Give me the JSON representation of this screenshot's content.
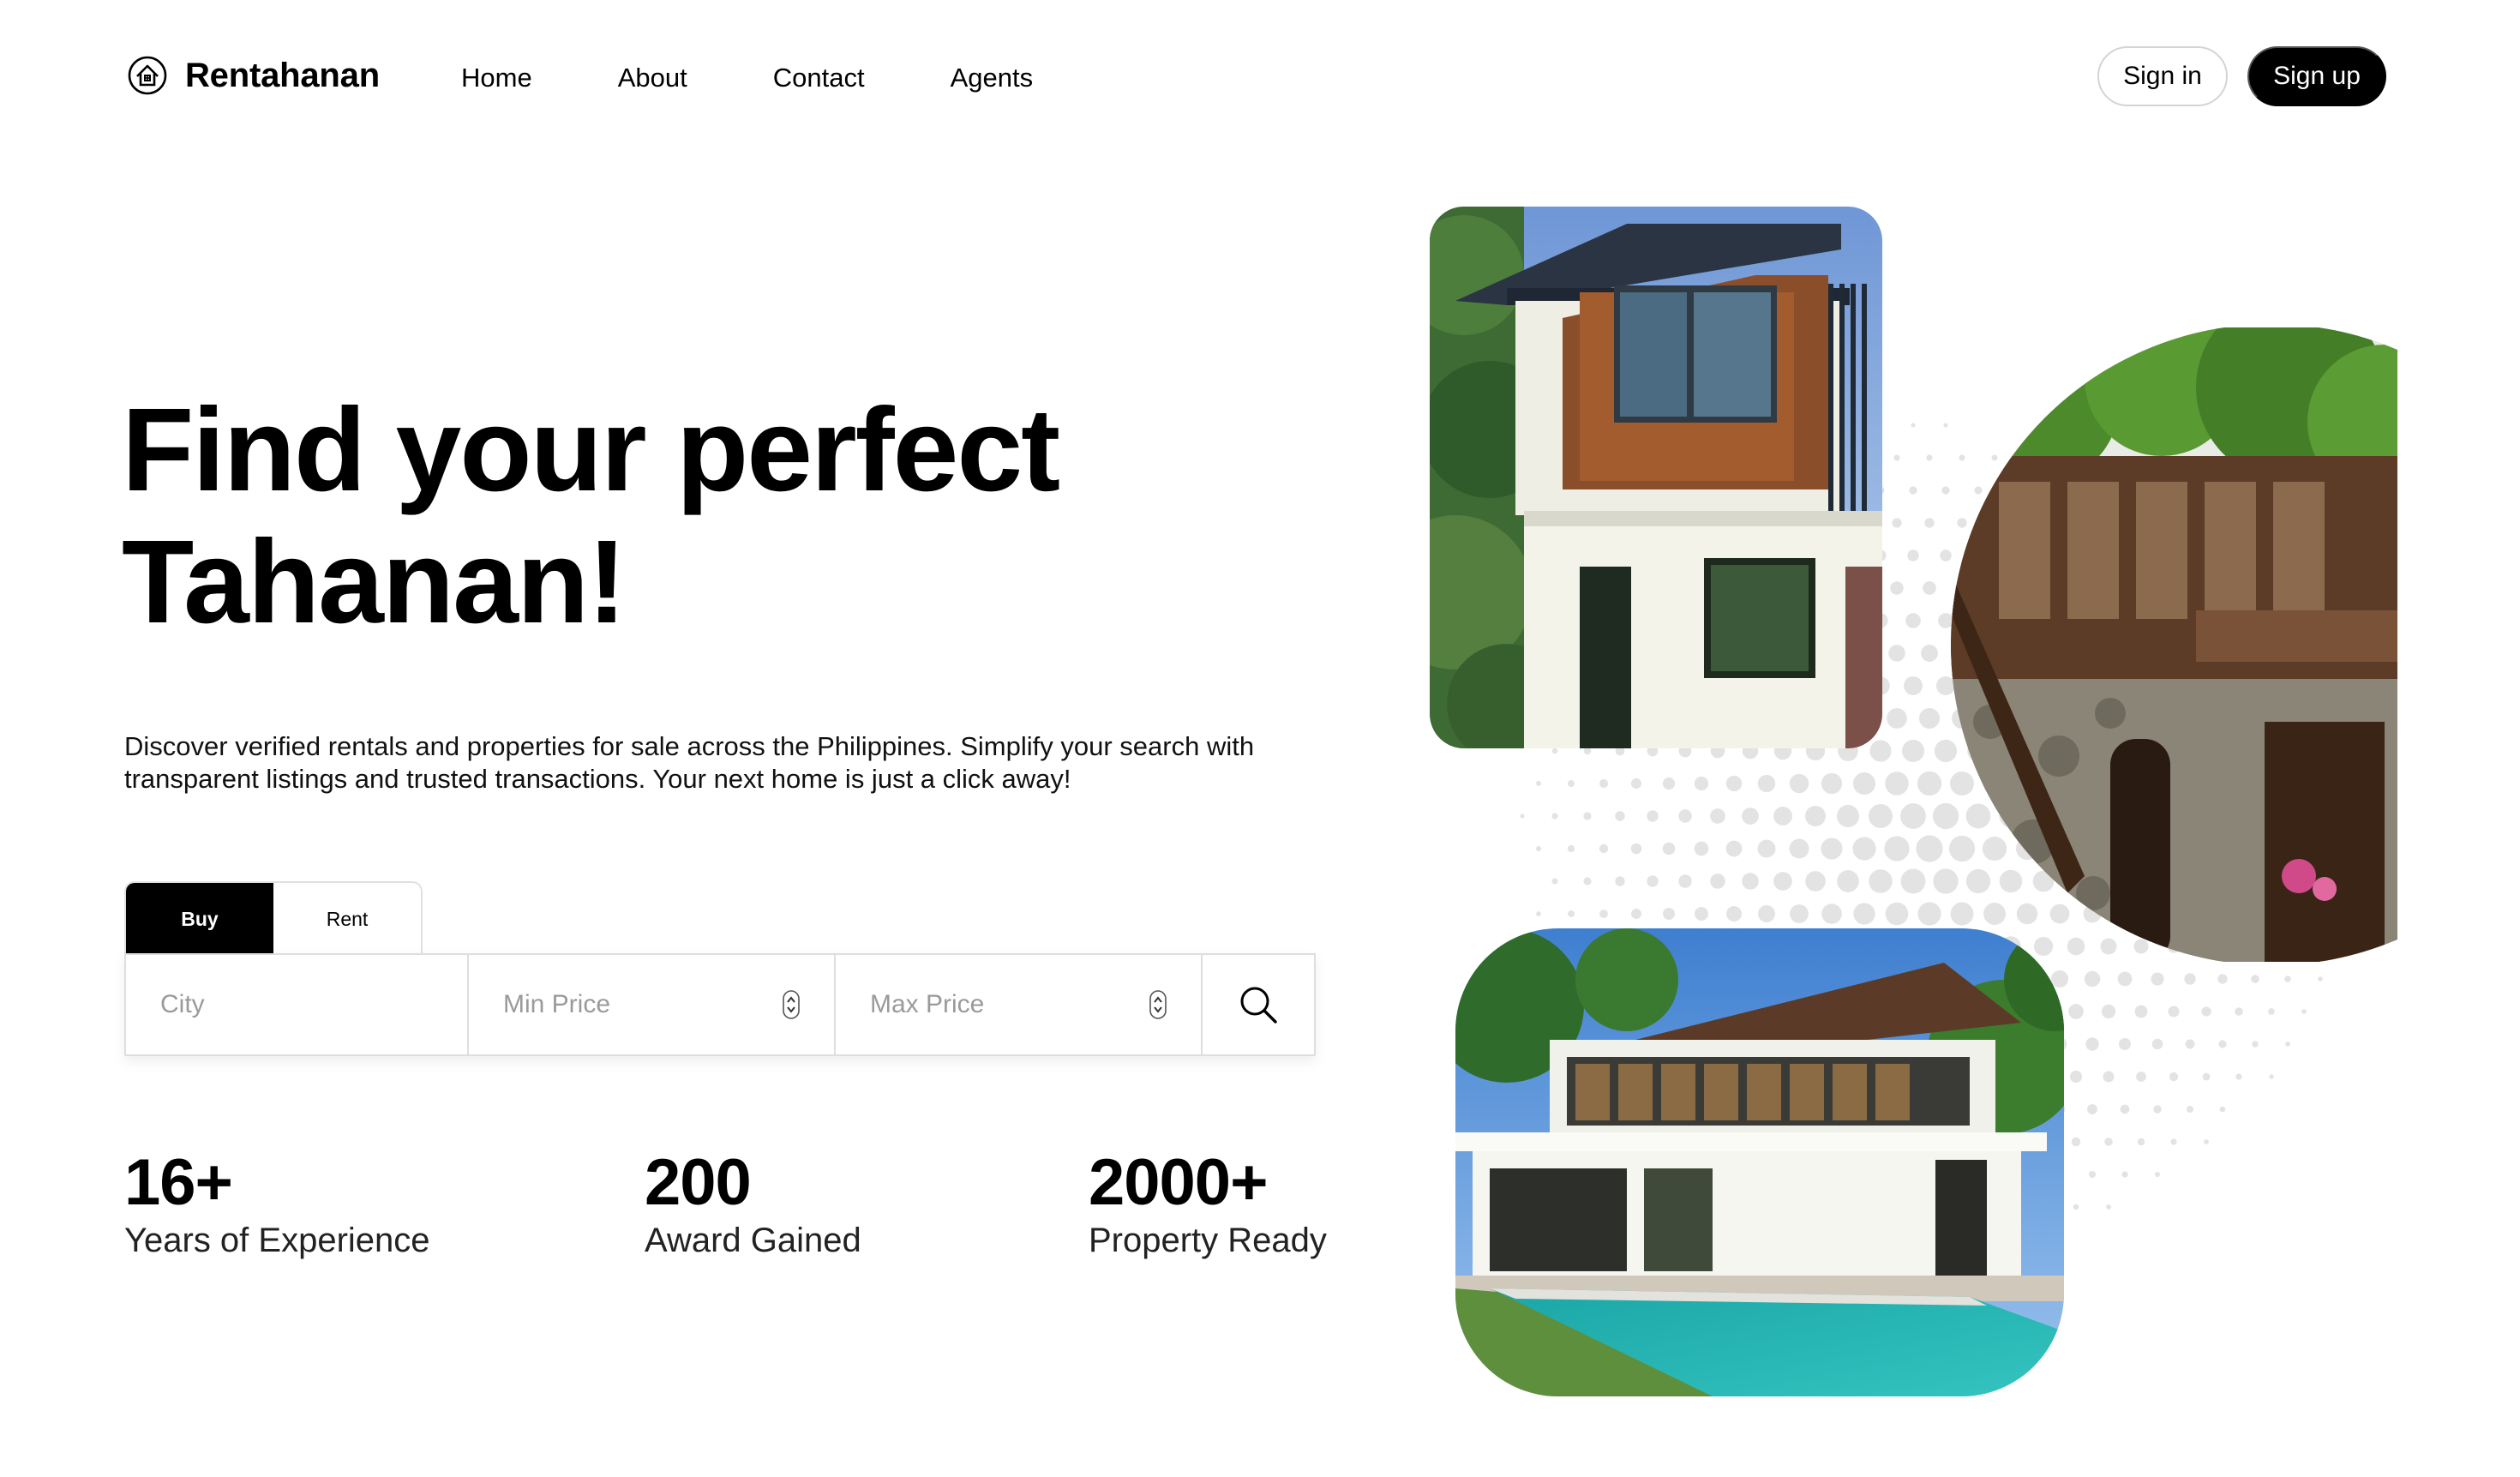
{
  "brand": {
    "name": "Rentahanan",
    "icon": "house-badge-icon"
  },
  "nav": {
    "items": [
      {
        "label": "Home"
      },
      {
        "label": "About"
      },
      {
        "label": "Contact"
      },
      {
        "label": "Agents"
      }
    ]
  },
  "auth": {
    "signin_label": "Sign in",
    "signup_label": "Sign up"
  },
  "hero": {
    "title_line1": "Find your perfect",
    "title_line2": "Tahanan!",
    "description": "Discover verified rentals and properties for sale across the Philippines. Simplify your search with transparent listings and trusted transactions. Your next home is just a click away!"
  },
  "search": {
    "tabs": [
      {
        "label": "Buy",
        "active": true
      },
      {
        "label": "Rent",
        "active": false
      }
    ],
    "city_placeholder": "City",
    "min_price_placeholder": "Min Price",
    "max_price_placeholder": "Max Price",
    "search_icon": "search-icon"
  },
  "stats": [
    {
      "value": "16+",
      "label": "Years of Experience"
    },
    {
      "value": "200",
      "label": "Award Gained"
    },
    {
      "value": "2000+",
      "label": "Property Ready"
    }
  ],
  "images": [
    {
      "name": "modern-two-storey-house-photo"
    },
    {
      "name": "heritage-stone-house-photo"
    },
    {
      "name": "modern-villa-with-pool-photo"
    }
  ],
  "colors": {
    "primary": "#000000",
    "background": "#ffffff",
    "border": "#dedede",
    "placeholder": "#9a9a9a",
    "dots": "#e3e3e3"
  }
}
